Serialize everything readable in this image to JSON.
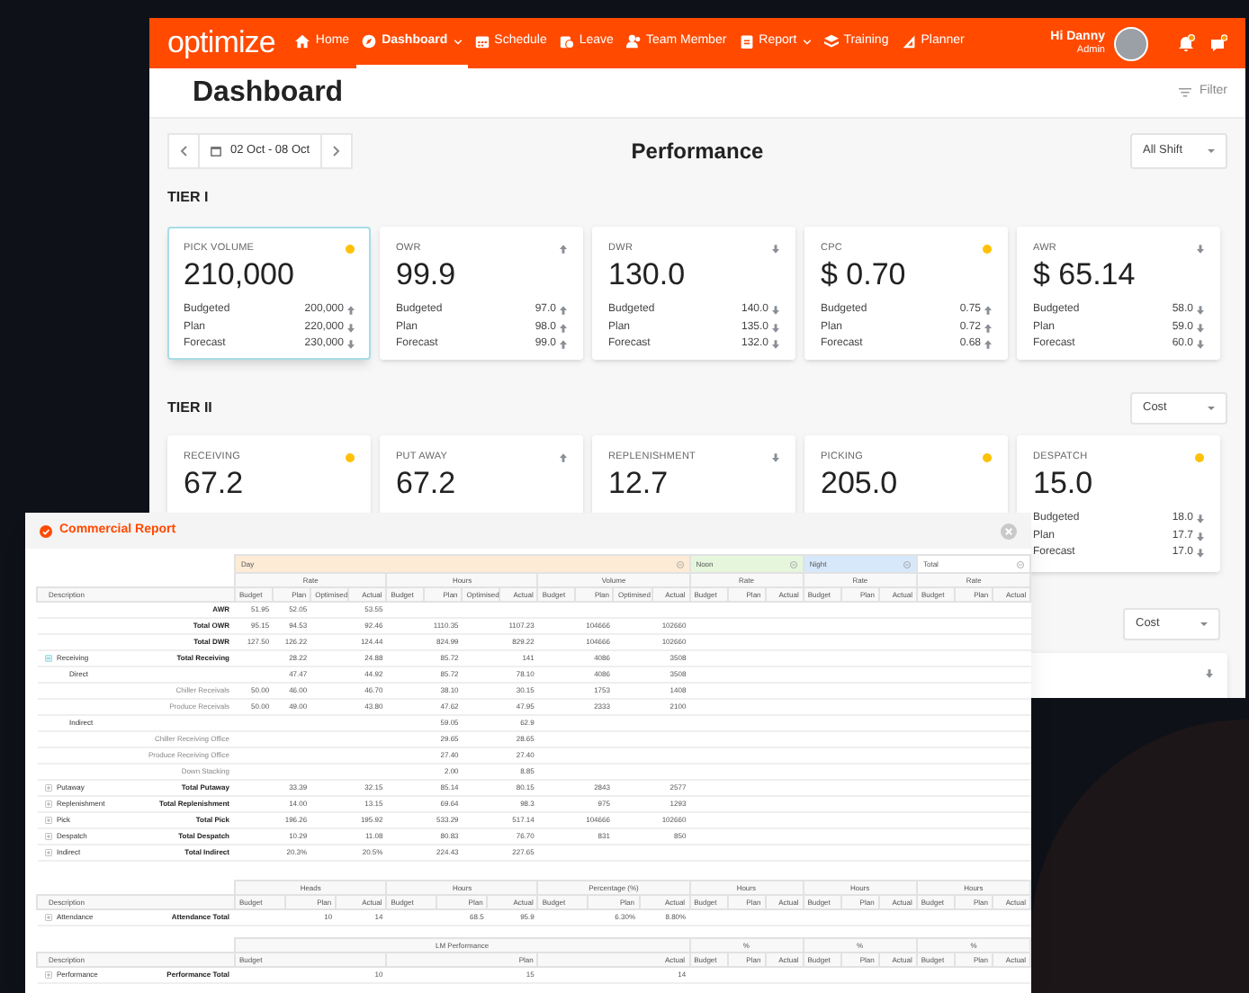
{
  "nav": {
    "logo": "optimize",
    "items": [
      {
        "label": "Home",
        "selected": false,
        "dropdown": false
      },
      {
        "label": "Dashboard",
        "selected": true,
        "dropdown": true
      },
      {
        "label": "Schedule",
        "selected": false,
        "dropdown": false
      },
      {
        "label": "Leave",
        "selected": false,
        "dropdown": false
      },
      {
        "label": "Team Member",
        "selected": false,
        "dropdown": false
      },
      {
        "label": "Report",
        "selected": false,
        "dropdown": true
      },
      {
        "label": "Training",
        "selected": false,
        "dropdown": false
      },
      {
        "label": "Planner",
        "selected": false,
        "dropdown": false
      }
    ],
    "user": {
      "greeting": "Hi Danny",
      "role": "Admin"
    }
  },
  "header": {
    "title": "Dashboard",
    "filter": "Filter"
  },
  "toolbar": {
    "date_range": "02 Oct - 08 Oct",
    "title": "Performance",
    "shift": "All Shift"
  },
  "tier_1": {
    "title": "TIER I",
    "cards": [
      {
        "title": "PICK VOLUME",
        "value": "210,000",
        "alert": true,
        "selected": true,
        "rows": [
          {
            "label": "Budgeted",
            "value": "200,000",
            "rising": true
          },
          {
            "label": "Plan",
            "value": "220,000",
            "rising": false
          },
          {
            "label": "Forecast",
            "value": "230,000",
            "rising": false
          }
        ]
      },
      {
        "title": "OWR",
        "value": "99.9",
        "alert": false,
        "rising": true,
        "selected": false,
        "rows": [
          {
            "label": "Budgeted",
            "value": "97.0",
            "rising": true
          },
          {
            "label": "Plan",
            "value": "98.0",
            "rising": true
          },
          {
            "label": "Forecast",
            "value": "99.0",
            "rising": true
          }
        ]
      },
      {
        "title": "DWR",
        "value": "130.0",
        "alert": false,
        "rising": false,
        "selected": false,
        "rows": [
          {
            "label": "Budgeted",
            "value": "140.0",
            "rising": false
          },
          {
            "label": "Plan",
            "value": "135.0",
            "rising": false
          },
          {
            "label": "Forecast",
            "value": "132.0",
            "rising": false
          }
        ]
      },
      {
        "title": "CPC",
        "value": "$ 0.70",
        "alert": true,
        "selected": false,
        "rows": [
          {
            "label": "Budgeted",
            "value": "0.75",
            "rising": true
          },
          {
            "label": "Plan",
            "value": "0.72",
            "rising": true
          },
          {
            "label": "Forecast",
            "value": "0.68",
            "rising": true
          }
        ]
      },
      {
        "title": "AWR",
        "value": "$ 65.14",
        "alert": false,
        "rising": false,
        "selected": false,
        "rows": [
          {
            "label": "Budgeted",
            "value": "58.0",
            "rising": false
          },
          {
            "label": "Plan",
            "value": "59.0",
            "rising": false
          },
          {
            "label": "Forecast",
            "value": "60.0",
            "rising": false
          }
        ]
      }
    ]
  },
  "tier_2": {
    "title": "TIER II",
    "select": "Cost",
    "cards": [
      {
        "title": "RECEIVING",
        "value": "67.2",
        "alert": true,
        "selected": false
      },
      {
        "title": "PUT AWAY",
        "value": "67.2",
        "alert": false,
        "rising": true,
        "selected": false
      },
      {
        "title": "REPLENISHMENT",
        "value": "12.7",
        "alert": false,
        "rising": false,
        "selected": false
      },
      {
        "title": "PICKING",
        "value": "205.0",
        "alert": true,
        "selected": false
      },
      {
        "title": "DESPATCH",
        "value": "15.0",
        "alert": true,
        "selected": false,
        "rows": [
          {
            "label": "Budgeted",
            "value": "18.0",
            "rising": false
          },
          {
            "label": "Plan",
            "value": "17.7",
            "rising": false
          },
          {
            "label": "Forecast",
            "value": "17.0",
            "rising": false
          }
        ]
      }
    ]
  },
  "tier_3": {
    "select": "Cost",
    "cards": [
      {
        "alert": false,
        "rising": false
      }
    ]
  },
  "report": {
    "title": "Commercial Report",
    "tables": [
      {
        "groups": [
          {
            "label": "Day",
            "color": "#fdebd6",
            "collapse_button": true,
            "subgroups": [
              {
                "label": "Rate",
                "columns": [
                  "Budget",
                  "Plan",
                  "Optimised",
                  "Actual"
                ]
              },
              {
                "label": "Hours",
                "columns": [
                  "Budget",
                  "Plan",
                  "Optimised",
                  "Actual"
                ]
              },
              {
                "label": "Volume",
                "columns": [
                  "Budget",
                  "Plan",
                  "Optimised",
                  "Actual"
                ]
              }
            ]
          },
          {
            "label": "Noon",
            "color": "#e5f6dc",
            "collapse_button": true,
            "subgroups": [
              {
                "label": "Rate",
                "columns": [
                  "Budget",
                  "Plan",
                  "Actual"
                ]
              }
            ]
          },
          {
            "label": "Night",
            "color": "#d7e8fb",
            "collapse_button": true,
            "subgroups": [
              {
                "label": "Rate",
                "columns": [
                  "Budget",
                  "Plan",
                  "Actual"
                ]
              }
            ]
          },
          {
            "label": "Total",
            "color": "#ffffff",
            "collapse_button": true,
            "subgroups": [
              {
                "label": "Rate",
                "columns": [
                  "Budget",
                  "Plan",
                  "Actual"
                ]
              }
            ]
          }
        ],
        "description": "Description",
        "rows": [
          {
            "kind": "total",
            "label": "AWR",
            "cells": [
              "51.95",
              "52.05",
              null,
              "53.55"
            ]
          },
          {
            "kind": "total",
            "label": "Total OWR",
            "cells": [
              "95.15",
              "94.53",
              null,
              "92.46",
              null,
              "1110.35",
              null,
              "1107.23",
              null,
              "104666",
              null,
              "102660"
            ]
          },
          {
            "kind": "total",
            "label": "Total DWR",
            "cells": [
              "127.50",
              "126.22",
              null,
              "124.44",
              null,
              "824.99",
              null,
              "829.22",
              null,
              "104666",
              null,
              "102660"
            ]
          },
          {
            "kind": "group",
            "group": "Receiving",
            "expanded": true,
            "label": "Total Receiving",
            "cells": [
              null,
              "28.22",
              null,
              "24.88",
              null,
              "85.72",
              null,
              "141",
              null,
              "4086",
              null,
              "3508"
            ]
          },
          {
            "kind": "subgroup",
            "group": "Direct",
            "cells": [
              null,
              "47.47",
              null,
              "44.92",
              null,
              "85.72",
              null,
              "78.10",
              null,
              "4086",
              null,
              "3508"
            ]
          },
          {
            "kind": "item",
            "label": "Chiller Receivals",
            "cells": [
              "50.00",
              "46.00",
              null,
              "46.70",
              null,
              "38.10",
              null,
              "30.15",
              null,
              "1753",
              null,
              "1408"
            ]
          },
          {
            "kind": "item",
            "label": "Produce Receivals",
            "cells": [
              "50.00",
              "49.00",
              null,
              "43.80",
              null,
              "47.62",
              null,
              "47.95",
              null,
              "2333",
              null,
              "2100"
            ]
          },
          {
            "kind": "subgroup",
            "group": "Indirect",
            "cells": [
              null,
              null,
              null,
              null,
              null,
              "59.05",
              null,
              "62.9"
            ]
          },
          {
            "kind": "item",
            "label": "Chiller Receiving Office",
            "cells": [
              null,
              null,
              null,
              null,
              null,
              "29.65",
              null,
              "28.65"
            ]
          },
          {
            "kind": "item",
            "label": "Produce Receiving Office",
            "cells": [
              null,
              null,
              null,
              null,
              null,
              "27.40",
              null,
              "27.40"
            ]
          },
          {
            "kind": "item",
            "label": "Down Stacking",
            "cells": [
              null,
              null,
              null,
              null,
              null,
              "2.00",
              null,
              "8.85"
            ]
          },
          {
            "kind": "group",
            "group": "Putaway",
            "expanded": false,
            "label": "Total Putaway",
            "cells": [
              null,
              "33.39",
              null,
              "32.15",
              null,
              "85.14",
              null,
              "80.15",
              null,
              "2843",
              null,
              "2577"
            ]
          },
          {
            "kind": "group",
            "group": "Replenishment",
            "expanded": false,
            "label": "Total Replenishment",
            "cells": [
              null,
              "14.00",
              null,
              "13.15",
              null,
              "69.64",
              null,
              "98.3",
              null,
              "975",
              null,
              "1293"
            ]
          },
          {
            "kind": "group",
            "group": "Pick",
            "expanded": false,
            "label": "Total Pick",
            "cells": [
              null,
              "196.26",
              null,
              "195.92",
              null,
              "533.29",
              null,
              "517.14",
              null,
              "104666",
              null,
              "102660"
            ]
          },
          {
            "kind": "group",
            "group": "Despatch",
            "expanded": false,
            "label": "Total Despatch",
            "cells": [
              null,
              "10.29",
              null,
              "11.08",
              null,
              "80.83",
              null,
              "76.70",
              null,
              "831",
              null,
              "850"
            ]
          },
          {
            "kind": "group",
            "group": "Indirect",
            "expanded": false,
            "label": "Total Indirect",
            "cells": [
              null,
              "20.3%",
              null,
              "20.5%",
              null,
              "224.43",
              null,
              "227.65"
            ]
          }
        ]
      },
      {
        "groups": [
          {
            "label": "Heads",
            "columns": [
              "Budget",
              "Plan",
              "Actual"
            ]
          },
          {
            "label": "Hours",
            "columns": [
              "Budget",
              "Plan",
              "Actual"
            ]
          },
          {
            "label": "Percentage (%)",
            "columns": [
              "Budget",
              "Plan",
              "Actual"
            ]
          },
          {
            "label": "Hours",
            "columns": [
              "Budget",
              "Plan",
              "Actual"
            ]
          },
          {
            "label": "Hours",
            "columns": [
              "Budget",
              "Plan",
              "Actual"
            ]
          },
          {
            "label": "Hours",
            "columns": [
              "Budget",
              "Plan",
              "Actual"
            ]
          }
        ],
        "description": "Description",
        "rows": [
          {
            "kind": "group",
            "group": "Attendance",
            "expanded": false,
            "label": "Attendance Total",
            "cells": [
              null,
              "10",
              "14",
              null,
              "68.5",
              "95.9",
              null,
              "6.30%",
              "8.80%"
            ]
          }
        ]
      },
      {
        "groups": [
          {
            "label": "LM Performance",
            "columns": [
              "Budget",
              "Plan",
              "Actual"
            ]
          },
          {
            "label": "%",
            "columns": [
              "Budget",
              "Plan",
              "Actual"
            ]
          },
          {
            "label": "%",
            "columns": [
              "Budget",
              "Plan",
              "Actual"
            ]
          },
          {
            "label": "%",
            "columns": [
              "Budget",
              "Plan",
              "Actual"
            ]
          }
        ],
        "description": "Description",
        "rows": [
          {
            "kind": "group",
            "group": "Performance",
            "expanded": false,
            "label": "Performance Total",
            "cells": [
              "10",
              "15",
              "14"
            ]
          }
        ]
      }
    ]
  }
}
